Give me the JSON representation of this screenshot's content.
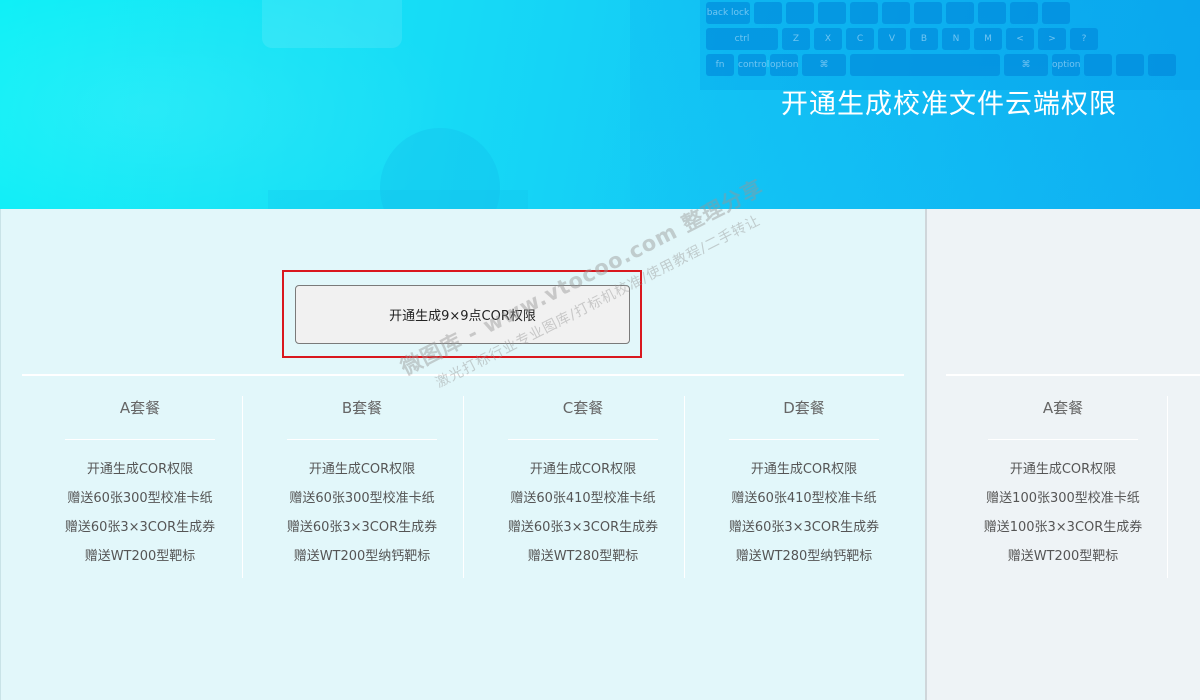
{
  "banner": {
    "title": "开通生成校准文件云端权限",
    "keyboard_keys": {
      "row1": [
        "back lock",
        "",
        "",
        "",
        "",
        "",
        "",
        "",
        "",
        ""
      ],
      "row2": [
        "ctrl",
        "Z",
        "X",
        "C",
        "V",
        "B",
        "N",
        "M",
        "<",
        ">",
        "?"
      ],
      "row3": [
        "fn",
        "control",
        "option",
        "⌘",
        "",
        "⌘",
        "option",
        "",
        "",
        ""
      ]
    }
  },
  "cta": {
    "label": "开通生成9×9点COR权限"
  },
  "packages": [
    {
      "title": "A套餐",
      "items": [
        "开通生成COR权限",
        "赠送60张300型校准卡纸",
        "赠送60张3×3COR生成券",
        "赠送WT200型靶标"
      ]
    },
    {
      "title": "B套餐",
      "items": [
        "开通生成COR权限",
        "赠送60张300型校准卡纸",
        "赠送60张3×3COR生成券",
        "赠送WT200型纳钙靶标"
      ]
    },
    {
      "title": "C套餐",
      "items": [
        "开通生成COR权限",
        "赠送60张410型校准卡纸",
        "赠送60张3×3COR生成券",
        "赠送WT280型靶标"
      ]
    },
    {
      "title": "D套餐",
      "items": [
        "开通生成COR权限",
        "赠送60张410型校准卡纸",
        "赠送60张3×3COR生成券",
        "赠送WT280型纳钙靶标"
      ]
    }
  ],
  "side_package": {
    "title": "A套餐",
    "items": [
      "开通生成COR权限",
      "赠送100张300型校准卡纸",
      "赠送100张3×3COR生成券",
      "赠送WT200型靶标"
    ]
  },
  "watermark": {
    "line1": "微图库 - www.vtocoo.com 整理分享",
    "line2": "激光打标行业专业图库/打标机校准/使用教程/二手转让"
  },
  "colors": {
    "banner_start": "#0cf0f7",
    "banner_end": "#0fb1f2",
    "main_bg": "#e2f7fa",
    "side_bg": "#eef3f6",
    "highlight_border": "#d9181e"
  }
}
